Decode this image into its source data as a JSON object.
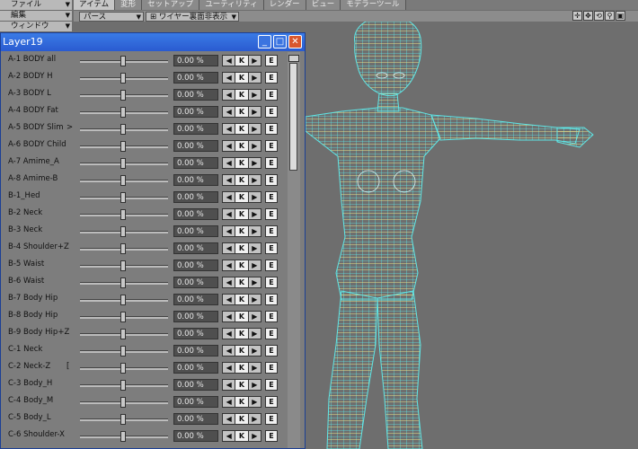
{
  "menus": [
    {
      "label": "ファイル"
    },
    {
      "label": "編集"
    },
    {
      "label": "ウィンドウ"
    }
  ],
  "tabs": [
    {
      "label": "アイテム",
      "active": true
    },
    {
      "label": "変形",
      "active": false
    },
    {
      "label": "セットアップ",
      "active": false
    },
    {
      "label": "ユーティリティ",
      "active": false
    },
    {
      "label": "レンダー",
      "active": false
    },
    {
      "label": "ビュー",
      "active": false
    },
    {
      "label": "モデラーツール",
      "active": false
    }
  ],
  "toolbar": {
    "view_mode": "パース",
    "display_mode": "ワイヤー裏面非表示"
  },
  "viewport_icons": [
    "move-icon",
    "pan-icon",
    "rotate-icon",
    "zoom-icon",
    "maximize-icon"
  ],
  "panel": {
    "title": "Layer19",
    "rows": [
      {
        "label": "A-1 BODY all",
        "value": "0.00 %",
        "key": "K",
        "edit": "E"
      },
      {
        "label": "A-2 BODY H",
        "value": "0.00 %",
        "key": "K",
        "edit": "E"
      },
      {
        "label": "A-3 BODY L",
        "value": "0.00 %",
        "key": "K",
        "edit": "E"
      },
      {
        "label": "A-4 BODY Fat",
        "value": "0.00 %",
        "key": "K",
        "edit": "E"
      },
      {
        "label": "A-5 BODY Slim",
        "extra": ">",
        "value": "0.00 %",
        "key": "K",
        "edit": "E"
      },
      {
        "label": "A-6 BODY Child",
        "value": "0.00 %",
        "key": "K",
        "edit": "E"
      },
      {
        "label": "A-7 Amime_A",
        "value": "0.00 %",
        "key": "K",
        "edit": "E"
      },
      {
        "label": "A-8 Amime-B",
        "value": "0.00 %",
        "key": "K",
        "edit": "E"
      },
      {
        "label": "B-1_Hed",
        "value": "0.00 %",
        "key": "K",
        "edit": "E"
      },
      {
        "label": "B-2 Neck",
        "value": "0.00 %",
        "key": "K",
        "edit": "E"
      },
      {
        "label": "B-3 Neck",
        "value": "0.00 %",
        "key": "K",
        "edit": "E"
      },
      {
        "label": "B-4 Shoulder+Z",
        "value": "0.00 %",
        "key": "K",
        "edit": "E"
      },
      {
        "label": "B-5 Waist",
        "value": "0.00 %",
        "key": "K",
        "edit": "E"
      },
      {
        "label": "B-6 Waist",
        "value": "0.00 %",
        "key": "K",
        "edit": "E"
      },
      {
        "label": "B-7 Body  Hip",
        "value": "0.00 %",
        "key": "K",
        "edit": "E"
      },
      {
        "label": "B-8 Body  Hip",
        "value": "0.00 %",
        "key": "K",
        "edit": "E"
      },
      {
        "label": "B-9 Body  Hip+Z",
        "value": "0.00 %",
        "key": "K",
        "edit": "E"
      },
      {
        "label": "C-1 Neck",
        "value": "0.00 %",
        "key": "K",
        "edit": "E"
      },
      {
        "label": "C-2 Neck-Z",
        "extra": "[",
        "value": "0.00 %",
        "key": "K",
        "edit": "E"
      },
      {
        "label": "C-3 Body_H",
        "value": "0.00 %",
        "key": "K",
        "edit": "E"
      },
      {
        "label": "C-4 Body_M",
        "value": "0.00 %",
        "key": "K",
        "edit": "E"
      },
      {
        "label": "C-5 Body_L",
        "value": "0.00 %",
        "key": "K",
        "edit": "E"
      },
      {
        "label": "C-6 Shoulder-X",
        "value": "0.00 %",
        "key": "K",
        "edit": "E"
      }
    ]
  },
  "colors": {
    "titlebar": "#2a5bd0",
    "wireframe": "#5fe6e6",
    "wireframe_alt": "#e8e08a",
    "viewport_bg": "#6e6e6e"
  }
}
